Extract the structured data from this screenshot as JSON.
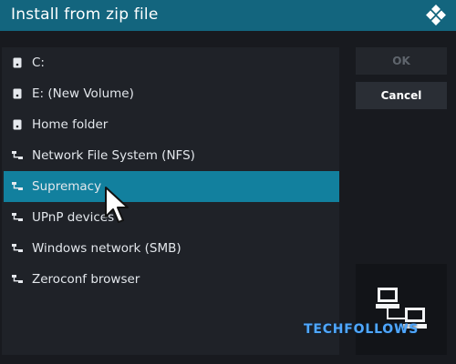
{
  "dialog": {
    "title": "Install from zip file"
  },
  "items": [
    {
      "label": "C:",
      "icon": "drive-icon",
      "selected": false
    },
    {
      "label": "E: (New Volume)",
      "icon": "drive-icon",
      "selected": false
    },
    {
      "label": "Home folder",
      "icon": "drive-icon",
      "selected": false
    },
    {
      "label": "Network File System (NFS)",
      "icon": "network-icon",
      "selected": false
    },
    {
      "label": "Supremacy",
      "icon": "network-icon",
      "selected": true
    },
    {
      "label": "UPnP devices",
      "icon": "network-icon",
      "selected": false
    },
    {
      "label": "Windows network (SMB)",
      "icon": "network-icon",
      "selected": false
    },
    {
      "label": "Zeroconf browser",
      "icon": "network-icon",
      "selected": false
    }
  ],
  "buttons": {
    "ok_label": "OK",
    "cancel_label": "Cancel"
  },
  "watermark": "TECHFOLLOWS",
  "colors": {
    "titlebar": "#13657e",
    "selected": "#12809e",
    "background": "#181a1f"
  }
}
